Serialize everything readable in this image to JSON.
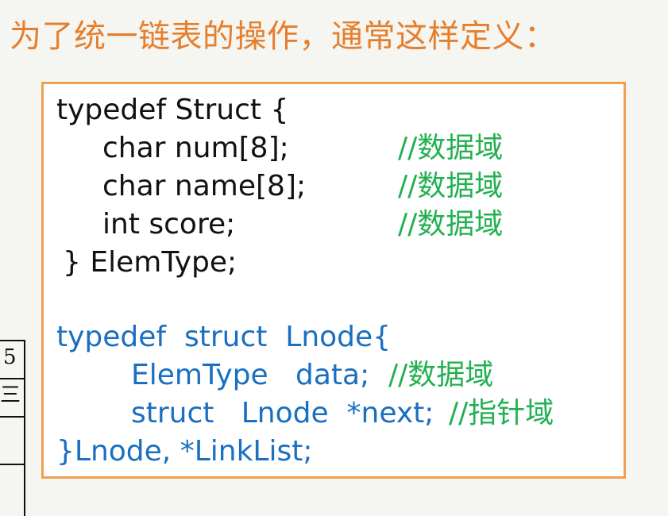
{
  "heading": "为了统一链表的操作，通常这样定义：",
  "code": {
    "struct_def": [
      {
        "text": "typedef Struct {",
        "comment": ""
      },
      {
        "text": "char num[8];",
        "comment": "//数据域"
      },
      {
        "text": "char name[8];",
        "comment": "//数据域"
      },
      {
        "text": "int score;",
        "comment": "//数据域"
      },
      {
        "text": "} ElemType;",
        "comment": ""
      }
    ],
    "node_def": [
      {
        "text": "typedef  struct  Lnode{",
        "comment": ""
      },
      {
        "text": "ElemType   data;",
        "comment": "//数据域"
      },
      {
        "text": "struct   Lnode  *next;",
        "comment": "//指针域"
      },
      {
        "text": "}Lnode, *LinkList;",
        "comment": ""
      }
    ]
  },
  "side_table": {
    "cells": [
      "5",
      "三",
      "",
      ""
    ]
  },
  "colors": {
    "heading": "#e57f2e",
    "border": "#f0a050",
    "code_black": "#111111",
    "code_blue": "#1a6fc0",
    "comment_green": "#22b050"
  }
}
